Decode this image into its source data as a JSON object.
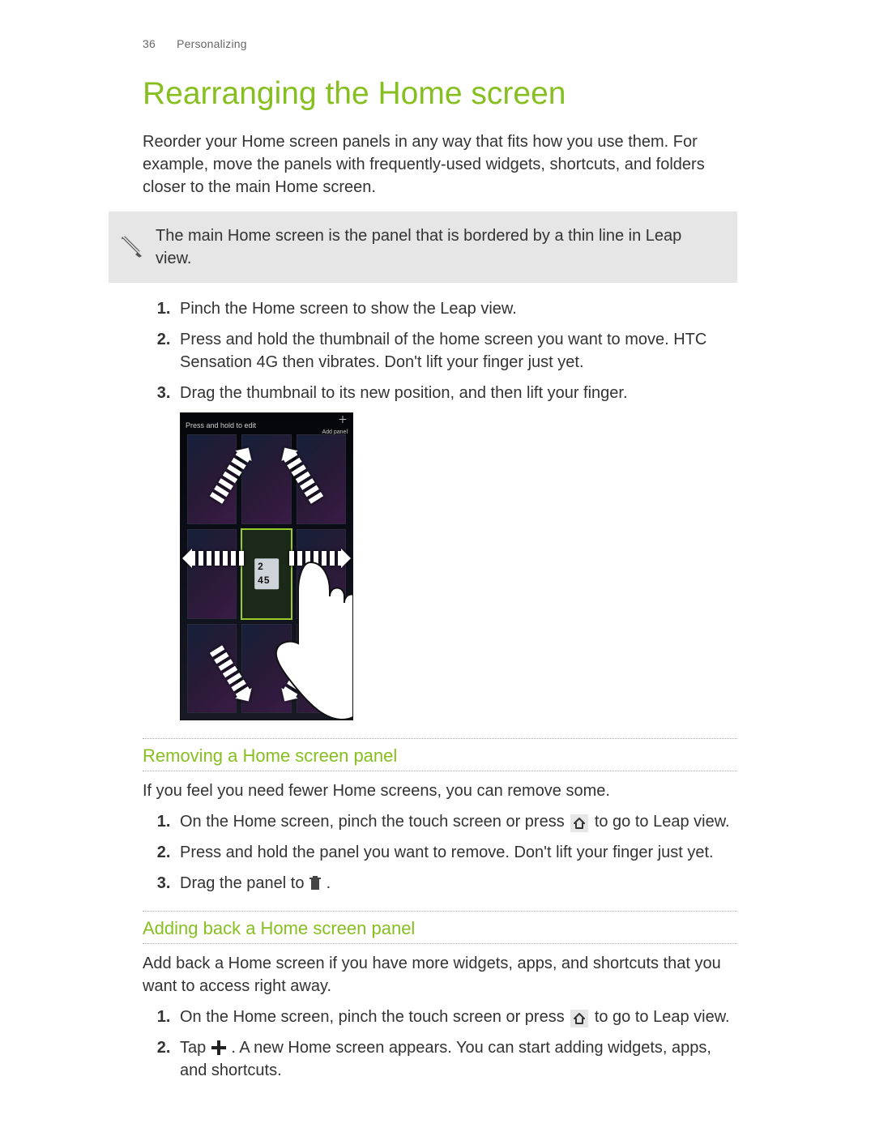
{
  "header": {
    "page_number": "36",
    "section": "Personalizing"
  },
  "title": "Rearranging the Home screen",
  "intro": "Reorder your Home screen panels in any way that fits how you use them. For example, move the panels with frequently-used widgets, shortcuts, and folders closer to the main Home screen.",
  "note": "The main Home screen is the panel that is bordered by a thin line in Leap view.",
  "steps": [
    "Pinch the Home screen to show the Leap view.",
    "Press and hold the thumbnail of the home screen you want to move. HTC Sensation 4G then vibrates. Don't lift your finger just yet.",
    "Drag the thumbnail to its new position, and then lift your finger."
  ],
  "figure": {
    "topbar_label": "Press and hold to edit",
    "topbar_action": "Add panel",
    "clock": "2 45"
  },
  "removing": {
    "heading": "Removing a Home screen panel",
    "intro": "If you feel you need fewer Home screens, you can remove some.",
    "steps": {
      "s1_a": "On the Home screen, pinch the touch screen or press ",
      "s1_b": " to go to Leap view.",
      "s2": "Press and hold the panel you want to remove. Don't lift your finger just yet.",
      "s3_a": "Drag the panel to ",
      "s3_b": "."
    }
  },
  "adding": {
    "heading": "Adding back a Home screen panel",
    "intro": "Add back a Home screen if you have more widgets, apps, and shortcuts that you want to access right away.",
    "steps": {
      "s1_a": "On the Home screen, pinch the touch screen or press ",
      "s1_b": " to go to Leap view.",
      "s2_a": "Tap ",
      "s2_b": ". A new Home screen appears. You can start adding widgets, apps, and shortcuts."
    }
  },
  "icons": {
    "home": "home-icon",
    "trash": "trash-icon",
    "plus": "plus-icon",
    "pen": "pen-icon"
  }
}
